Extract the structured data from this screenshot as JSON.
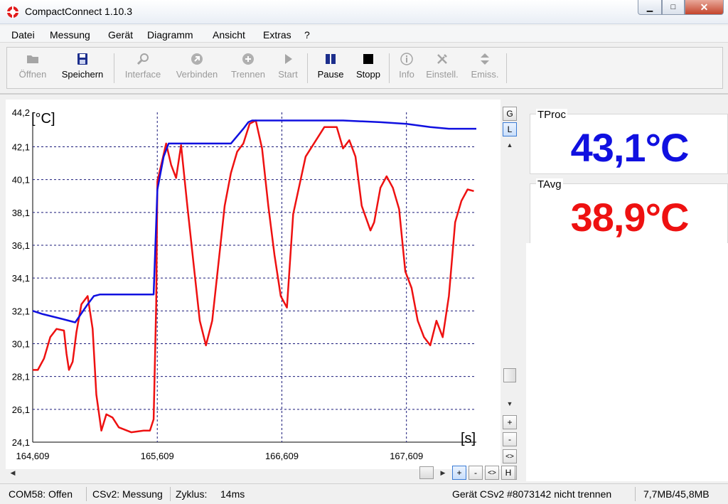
{
  "window": {
    "title": "CompactConnect 1.10.3",
    "close_glyph": "✕",
    "min_glyph": "▁",
    "max_glyph": "□"
  },
  "menu": [
    "Datei",
    "Messung",
    "Gerät",
    "Diagramm",
    "Ansicht",
    "Extras",
    "?"
  ],
  "toolbar": {
    "open": "Öffnen",
    "save": "Speichern",
    "interface": "Interface",
    "connect": "Verbinden",
    "disconnect": "Trennen",
    "start": "Start",
    "pause": "Pause",
    "stop": "Stopp",
    "info": "Info",
    "settings": "Einstell.",
    "emission": "Emiss."
  },
  "scroll_buttons": {
    "g": "G",
    "l": "L",
    "plus": "+",
    "minus": "-",
    "fit": "<>",
    "h": "H",
    "up": "▲",
    "down": "▼",
    "left": "◀",
    "right": "▶"
  },
  "readouts": {
    "tproc_label": "TProc",
    "tproc_value": "43,1°C",
    "tavg_label": "TAvg",
    "tavg_value": "38,9°C"
  },
  "colors": {
    "tproc": "#1010e0",
    "tavg": "#ee1111",
    "grid": "#1a1a7a"
  },
  "status": {
    "port": "COM58: Offen",
    "device": "CSv2: Messung",
    "cycle_label": "Zyklus:",
    "cycle_value": "14ms",
    "device_info": "Gerät CSv2 #8073142 nicht trennen",
    "memory": "7,7MB/45,8MB"
  },
  "chart_data": {
    "type": "line",
    "ylabel": "[°C]",
    "xlabel": "[s]",
    "ylim": [
      24.1,
      44.2
    ],
    "xlim": [
      164.609,
      168.17
    ],
    "yticks": [
      24.1,
      26.1,
      28.1,
      30.1,
      32.1,
      34.1,
      36.1,
      38.1,
      40.1,
      42.1,
      44.2
    ],
    "ytick_labels": [
      "24,1",
      "26,1",
      "28,1",
      "30,1",
      "32,1",
      "34,1",
      "36,1",
      "38,1",
      "40,1",
      "42,1",
      "44,2"
    ],
    "xticks": [
      164.609,
      165.609,
      166.609,
      167.609
    ],
    "xtick_labels": [
      "164,609",
      "165,609",
      "166,609",
      "167,609"
    ],
    "grid": true,
    "series": [
      {
        "name": "TProc",
        "x": [
          164.609,
          164.69,
          164.85,
          164.95,
          165.05,
          165.1,
          165.15,
          165.58,
          165.61,
          165.66,
          165.7,
          165.85,
          165.95,
          166.2,
          166.3,
          166.34,
          166.37,
          166.5,
          166.8,
          167.1,
          167.4,
          167.609,
          167.8,
          167.95,
          168.17
        ],
        "y": [
          32.1,
          31.9,
          31.6,
          31.4,
          32.5,
          33.0,
          33.1,
          33.1,
          39.5,
          41.5,
          42.3,
          42.3,
          42.3,
          42.3,
          43.2,
          43.6,
          43.7,
          43.7,
          43.7,
          43.7,
          43.6,
          43.5,
          43.3,
          43.2,
          43.2
        ]
      },
      {
        "name": "TAvg",
        "x": [
          164.609,
          164.65,
          164.7,
          164.75,
          164.8,
          164.86,
          164.88,
          164.9,
          164.93,
          164.96,
          165.0,
          165.05,
          165.09,
          165.12,
          165.16,
          165.2,
          165.25,
          165.3,
          165.4,
          165.5,
          165.55,
          165.58,
          165.6,
          165.61,
          165.65,
          165.68,
          165.72,
          165.76,
          165.8,
          165.85,
          165.9,
          165.95,
          166.0,
          166.05,
          166.1,
          166.15,
          166.2,
          166.25,
          166.3,
          166.35,
          166.4,
          166.45,
          166.5,
          166.55,
          166.6,
          166.65,
          166.7,
          166.8,
          166.95,
          167.05,
          167.1,
          167.15,
          167.2,
          167.25,
          167.32,
          167.35,
          167.4,
          167.45,
          167.5,
          167.55,
          167.6,
          167.65,
          167.7,
          167.75,
          167.8,
          167.85,
          167.9,
          167.95,
          168.0,
          168.05,
          168.1,
          168.15
        ],
        "y": [
          28.5,
          28.5,
          29.2,
          30.5,
          31.0,
          30.9,
          29.5,
          28.5,
          29.0,
          30.8,
          32.5,
          33.0,
          31.0,
          27.0,
          24.8,
          25.8,
          25.6,
          25.0,
          24.7,
          24.8,
          24.8,
          25.5,
          32.5,
          40.0,
          41.3,
          42.3,
          41.0,
          40.2,
          42.2,
          38.5,
          35.0,
          31.5,
          30.0,
          31.5,
          35.0,
          38.5,
          40.5,
          41.8,
          42.3,
          43.5,
          43.7,
          42.0,
          38.5,
          35.5,
          33.0,
          32.3,
          38.0,
          41.5,
          43.3,
          43.3,
          42.0,
          42.5,
          41.5,
          38.5,
          37.0,
          37.5,
          39.6,
          40.3,
          39.6,
          38.3,
          34.5,
          33.5,
          31.5,
          30.5,
          30.0,
          31.5,
          30.5,
          33.0,
          37.5,
          38.8,
          39.5,
          39.4
        ]
      }
    ]
  }
}
